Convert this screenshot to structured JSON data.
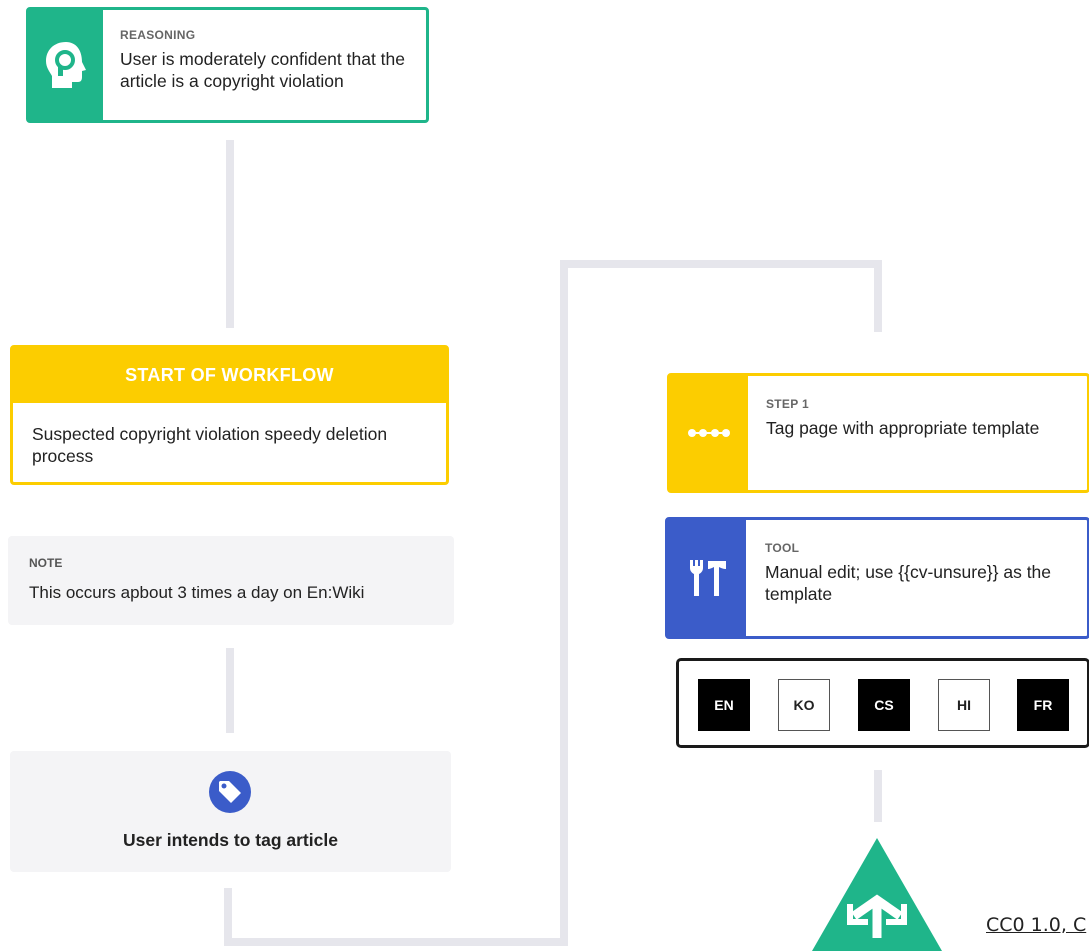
{
  "reasoning": {
    "label": "REASONING",
    "text": "User is moderately confident that the article is a copyright violation",
    "icon": "head-icon",
    "color": "#1fb58a"
  },
  "start": {
    "header": "START OF WORKFLOW",
    "text": "Suspected copyright violation speedy deletion process",
    "color": "#fccd00"
  },
  "note": {
    "label": "NOTE",
    "text": "This occurs apbout 3 times a day on En:Wiki"
  },
  "intent": {
    "text": "User intends to tag article",
    "icon": "tag-icon"
  },
  "step": {
    "label": "STEP 1",
    "text": "Tag page with appropriate template",
    "icon": "workflow-dots-icon",
    "color": "#fccd00"
  },
  "tool": {
    "label": "TOOL",
    "text": "Manual edit; use {{cv-unsure}} as the template",
    "icon": "tools-icon",
    "color": "#3b5cc9"
  },
  "languages": [
    {
      "code": "EN",
      "style": "dark"
    },
    {
      "code": "KO",
      "style": "light"
    },
    {
      "code": "CS",
      "style": "dark"
    },
    {
      "code": "HI",
      "style": "light"
    },
    {
      "code": "FR",
      "style": "dark"
    }
  ],
  "merge": {
    "icon": "merge-icon",
    "color": "#1fb58a"
  },
  "license": "CC0 1.0, C"
}
